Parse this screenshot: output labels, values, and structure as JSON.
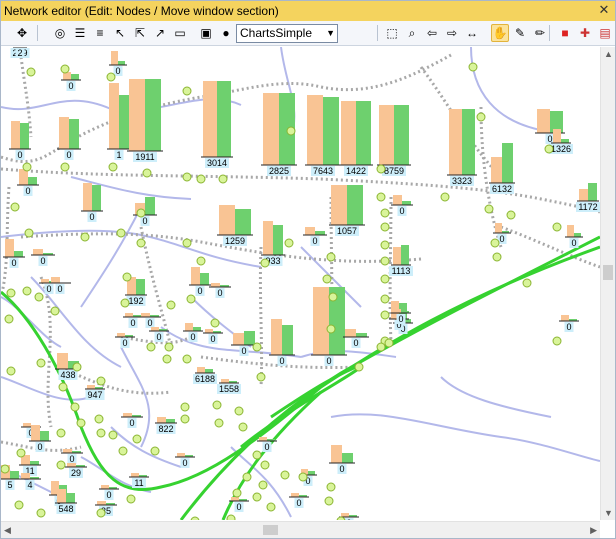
{
  "window": {
    "title": "Network editor (Edit: Nodes / Move window section)",
    "close_glyph": "✕"
  },
  "toolbar": {
    "chart_mode": "ChartsSimple"
  },
  "colors": {
    "bar_a": "#f9c494",
    "bar_b": "#6ed06e",
    "rail": "#36d230",
    "road": "#b3b8ea",
    "path": "#a8a8a8",
    "node": "#d9f49a",
    "label_bg": "#cdeefa"
  },
  "chart_labels": [
    "219",
    "0",
    "0",
    "0",
    "0",
    "1",
    "1911",
    "3014",
    "2825",
    "7643",
    "1422",
    "8759",
    "3323",
    "6132",
    "1172",
    "0",
    "1326",
    "0",
    "0",
    "0",
    "1259",
    "0",
    "933",
    "0",
    "1057",
    "0",
    "1113",
    "0",
    "0",
    "0",
    "0",
    "0",
    "192",
    "0",
    "0",
    "0",
    "0",
    "0",
    "0",
    "0",
    "0",
    "0",
    "0",
    "0",
    "0",
    "0",
    "0",
    "438",
    "947",
    "6188",
    "1558",
    "0",
    "0",
    "822",
    "0",
    "11",
    "0",
    "29",
    "5",
    "4",
    "0",
    "0",
    "11",
    "0",
    "0",
    "0",
    "0",
    "548",
    "35",
    "0",
    "0",
    "0",
    "0",
    "0",
    "2",
    "0"
  ]
}
